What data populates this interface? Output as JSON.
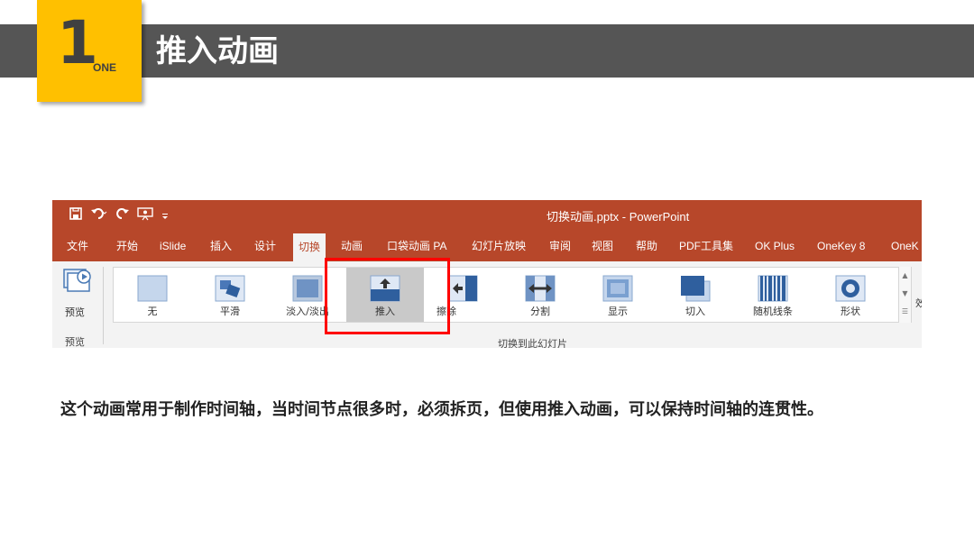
{
  "slide": {
    "badge_number": "1",
    "badge_word": "ONE",
    "title": "推入动画",
    "caption": "这个动画常用于制作时间轴，当时间节点很多时，必须拆页，但使用推入动画，可以保持时间轴的连贯性。",
    "colors": {
      "band": "#555555",
      "badge": "#FFC000",
      "ppt_accent": "#B7472A",
      "highlight": "#FF0000"
    }
  },
  "powerpoint": {
    "window_title": "切换动画.pptx - PowerPoint",
    "quick_access": [
      "save-icon",
      "undo-icon",
      "redo-icon",
      "present-icon",
      "customize-icon"
    ],
    "tabs": [
      {
        "label": "文件"
      },
      {
        "label": "开始"
      },
      {
        "label": "iSlide"
      },
      {
        "label": "插入"
      },
      {
        "label": "设计"
      },
      {
        "label": "切换",
        "active": true
      },
      {
        "label": "动画"
      },
      {
        "label": "口袋动画 PA"
      },
      {
        "label": "幻灯片放映"
      },
      {
        "label": "审阅"
      },
      {
        "label": "视图"
      },
      {
        "label": "帮助"
      },
      {
        "label": "PDF工具集"
      },
      {
        "label": "OK Plus"
      },
      {
        "label": "OneKey 8"
      },
      {
        "label": "OneK"
      }
    ],
    "preview": {
      "button_label": "预览",
      "group_label": "预览"
    },
    "transitions_group_label": "切换到此幻灯片",
    "effects": [
      {
        "label": "无",
        "icon": "none-icon"
      },
      {
        "label": "平滑",
        "icon": "morph-icon"
      },
      {
        "label": "淡入/淡出",
        "icon": "fade-icon"
      },
      {
        "label": "推入",
        "icon": "push-icon",
        "selected": true
      },
      {
        "label": "擦除",
        "icon": "wipe-icon"
      },
      {
        "label": "分割",
        "icon": "split-icon"
      },
      {
        "label": "显示",
        "icon": "reveal-icon"
      },
      {
        "label": "切入",
        "icon": "cut-icon"
      },
      {
        "label": "随机线条",
        "icon": "random-bars-icon"
      },
      {
        "label": "形状",
        "icon": "shape-icon"
      }
    ],
    "extra_label": "效"
  }
}
